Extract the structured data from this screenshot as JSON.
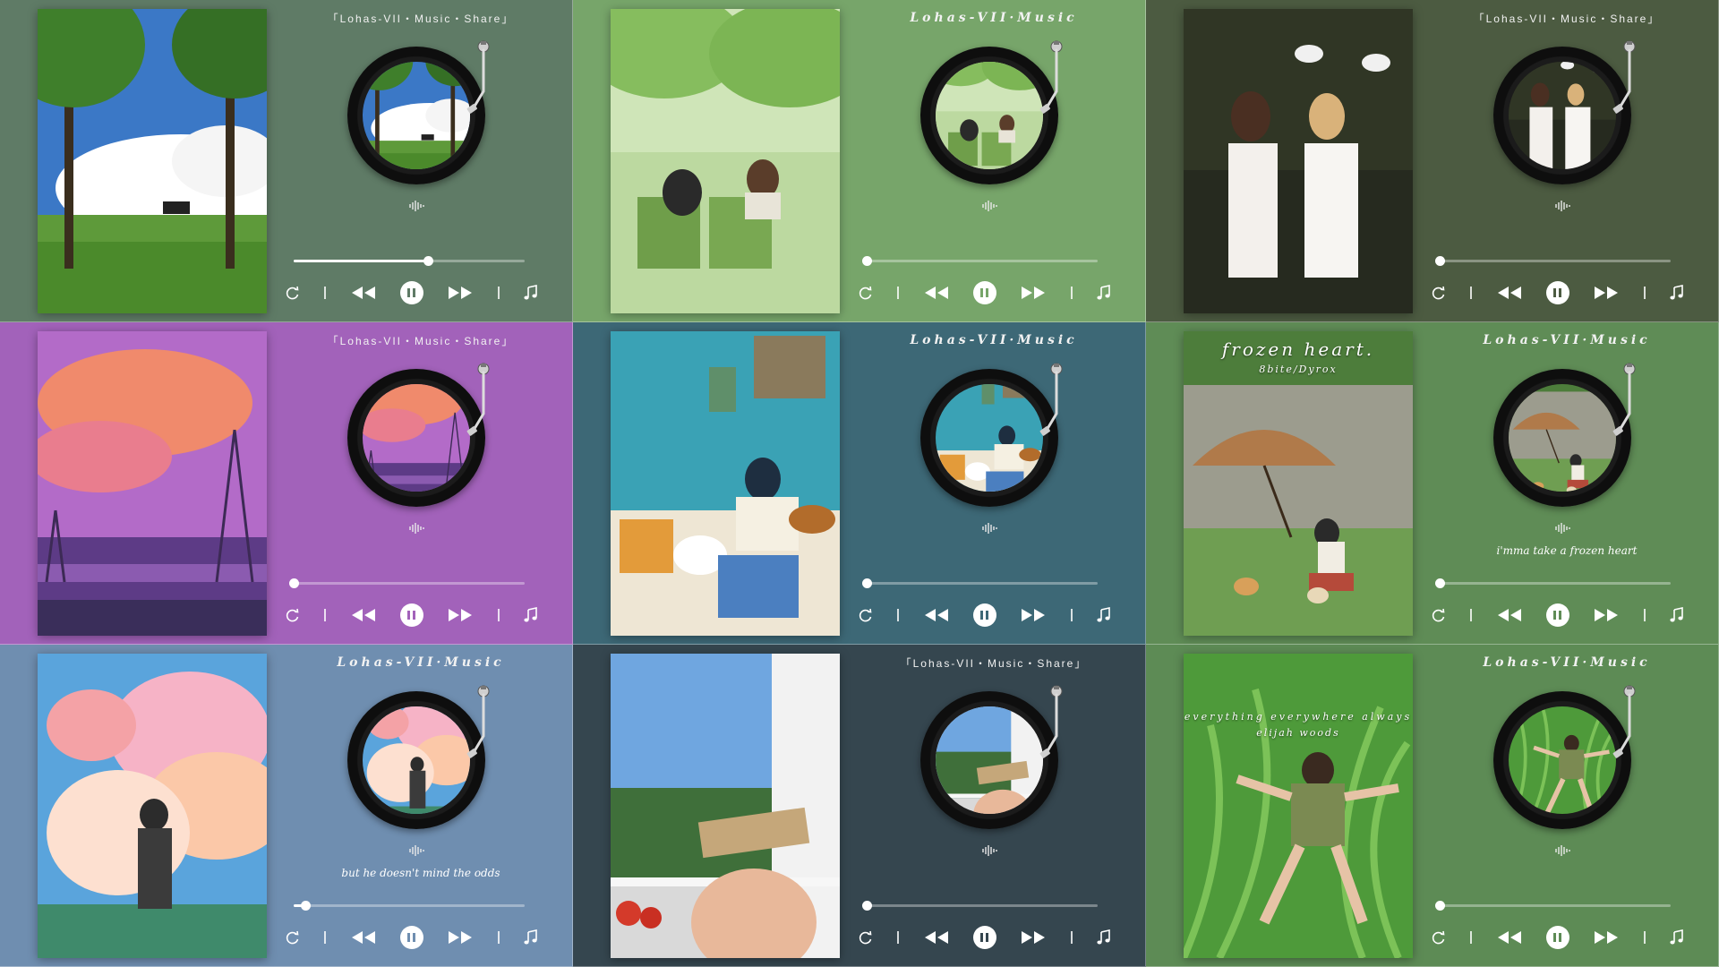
{
  "cards": [
    {
      "header": "「Lohas-VII・Music・Share」",
      "header_style": "plain",
      "bg": "#5f7b66",
      "art": "park-bench",
      "lyric": "",
      "progress": 0.58,
      "art_title": "",
      "art_sub": ""
    },
    {
      "header": "Lohas-VII·Music",
      "header_style": "script",
      "bg": "#77a56a",
      "art": "green-chairs",
      "lyric": "",
      "progress": 0.0,
      "art_title": "",
      "art_sub": ""
    },
    {
      "header": "「Lohas-VII・Music・Share」",
      "header_style": "plain",
      "bg": "#4c5b41",
      "art": "swans-girls",
      "lyric": "",
      "progress": 0.0,
      "art_title": "",
      "art_sub": ""
    },
    {
      "header": "「Lohas-VII・Music・Share」",
      "header_style": "plain",
      "bg": "#a262ba",
      "art": "pink-sky",
      "lyric": "",
      "progress": 0.0,
      "art_title": "",
      "art_sub": ""
    },
    {
      "header": "Lohas-VII·Music",
      "header_style": "script",
      "bg": "#3d6876",
      "art": "guitar-room",
      "lyric": "",
      "progress": 0.0,
      "art_title": "",
      "art_sub": ""
    },
    {
      "header": "Lohas-VII·Music",
      "header_style": "script",
      "bg": "#5f8c56",
      "art": "umbrella",
      "lyric": "i'mma take a frozen heart",
      "progress": 0.0,
      "art_title": "frozen heart.",
      "art_sub": "8bite/Dyrox"
    },
    {
      "header": "Lohas-VII·Music",
      "header_style": "script",
      "bg": "#6f8eb0",
      "art": "pastel-clouds",
      "lyric": "but he doesn't mind the odds",
      "progress": 0.05,
      "art_title": "",
      "art_sub": ""
    },
    {
      "header": "「Lohas-VII・Music・Share」",
      "header_style": "plain",
      "bg": "#35464f",
      "art": "window-book",
      "lyric": "",
      "progress": 0.0,
      "art_title": "",
      "art_sub": ""
    },
    {
      "header": "Lohas-VII·Music",
      "header_style": "script",
      "bg": "#5d8b55",
      "art": "grass-lying",
      "lyric": "",
      "progress": 0.0,
      "art_title": "everything everywhere always",
      "art_sub": "elijah woods"
    }
  ],
  "icons": {
    "repeat": "repeat-icon",
    "prev": "previous-icon",
    "pause": "pause-icon",
    "next": "next-icon",
    "playlist": "music-note-icon",
    "wave": "waveform-icon"
  }
}
